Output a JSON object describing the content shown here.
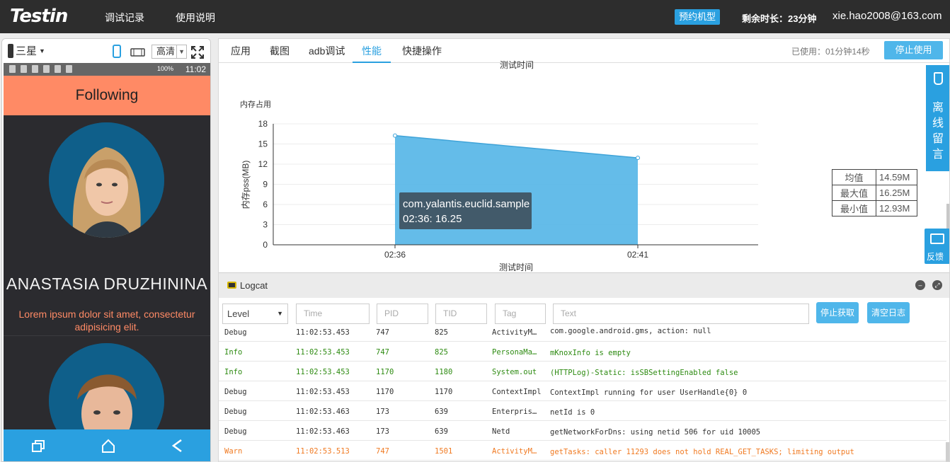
{
  "topbar": {
    "logo": "Testin",
    "nav": [
      "调试记录",
      "使用说明"
    ],
    "reserve_button": "预约机型",
    "remaining": "剩余时长：23分钟",
    "user_email": "xie.hao2008@163.com"
  },
  "device": {
    "name": "三星",
    "quality": "高清",
    "status_time": "11:02",
    "battery": "100%",
    "app_title": "Following",
    "person_name": "ANASTASIA DRUZHININA",
    "person_desc": "Lorem ipsum dolor sit amet, consectetur adipisicing elit."
  },
  "tabs": [
    {
      "label": "应用",
      "active": false
    },
    {
      "label": "截图",
      "active": false
    },
    {
      "label": "adb调试",
      "active": false
    },
    {
      "label": "性能",
      "active": true
    },
    {
      "label": "快捷操作",
      "active": false
    }
  ],
  "usage": {
    "used_text": "已使用：01分钟14秒",
    "stop_button": "停止使用"
  },
  "side_tabs": {
    "offline_message": "离线留言",
    "feedback": "反馈"
  },
  "chart_data": {
    "type": "area",
    "title": "内存占用",
    "top_partial_label": "测试时间",
    "xlabel": "测试时间",
    "ylabel": "内存pss(MB)",
    "categories": [
      "02:36",
      "02:41"
    ],
    "series": [
      {
        "name": "com.yalantis.euclid.sample",
        "values": [
          16.25,
          12.93
        ]
      }
    ],
    "ylim": [
      0,
      18
    ],
    "yticks": [
      0,
      3,
      6,
      9,
      12,
      15,
      18
    ],
    "color": "#5cb8e8",
    "tooltip": {
      "title": "com.yalantis.euclid.sample",
      "text": "02:36: 16.25"
    }
  },
  "stats": [
    {
      "label": "均值",
      "value": "14.59M"
    },
    {
      "label": "最大值",
      "value": "16.25M"
    },
    {
      "label": "最小值",
      "value": "12.93M"
    }
  ],
  "logcat": {
    "title": "Logcat",
    "filters": {
      "level": "Level",
      "time": "Time",
      "pid": "PID",
      "tid": "TID",
      "tag": "Tag",
      "text": "Text"
    },
    "stop_fetch_button": "停止获取",
    "clear_button": "清空日志",
    "rows": [
      {
        "level": "Debug",
        "time": "11:02:53.453",
        "pid": "747",
        "tid": "825",
        "tag": "ActivityM…",
        "msg": "com.google.android.gms, action: null"
      },
      {
        "level": "Info",
        "time": "11:02:53.453",
        "pid": "747",
        "tid": "825",
        "tag": "PersonaMa…",
        "msg": "mKnoxInfo is empty"
      },
      {
        "level": "Info",
        "time": "11:02:53.453",
        "pid": "1170",
        "tid": "1180",
        "tag": "System.out",
        "msg": "(HTTPLog)-Static: isSBSettingEnabled false"
      },
      {
        "level": "Debug",
        "time": "11:02:53.453",
        "pid": "1170",
        "tid": "1170",
        "tag": "ContextImpl",
        "msg": "ContextImpl running for user UserHandle{0} 0"
      },
      {
        "level": "Debug",
        "time": "11:02:53.463",
        "pid": "173",
        "tid": "639",
        "tag": "Enterpris…",
        "msg": "netId is 0"
      },
      {
        "level": "Debug",
        "time": "11:02:53.463",
        "pid": "173",
        "tid": "639",
        "tag": "Netd",
        "msg": "getNetworkForDns: using netid 506 for uid 10005"
      },
      {
        "level": "Warn",
        "time": "11:02:53.513",
        "pid": "747",
        "tid": "1501",
        "tag": "ActivityM…",
        "msg": "getTasks: caller 11293 does not hold REAL_GET_TASKS; limiting output"
      }
    ]
  }
}
